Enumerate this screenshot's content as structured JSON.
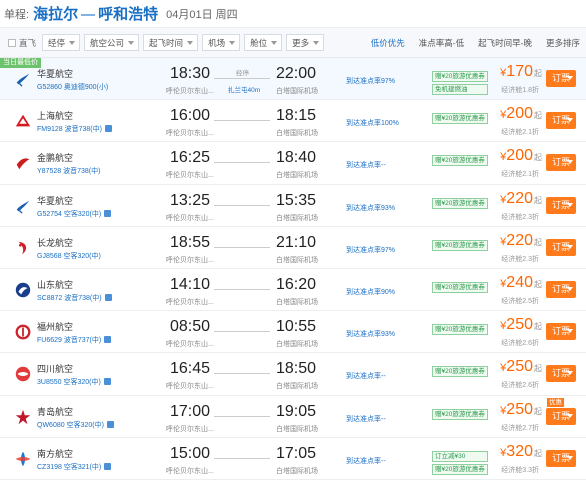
{
  "header": {
    "route_label": "单程:",
    "from_city": "海拉尔",
    "to_city": "呼和浩特",
    "date": "04月01日 周四"
  },
  "filters": {
    "direct_label": "直飞",
    "dropdowns": [
      "经停",
      "航空公司",
      "起飞时间",
      "机场",
      "舱位",
      "更多"
    ],
    "sorts": [
      "低价优先",
      "准点率高-低",
      "起飞时间早-晚",
      "更多排序"
    ],
    "active_sort_index": 0
  },
  "first_tag": "当日最低价",
  "flights": [
    {
      "airline": "华夏航空",
      "info": "G52860 奥迪德900(小)",
      "share": false,
      "dep_time": "18:30",
      "dep_airport": "呼伦贝尔东山...",
      "arr_time": "22:00",
      "arr_airport": "白塔国际机场",
      "stop_label": "经停",
      "stop_city": "扎兰屯40m",
      "ontime": "到达准点率97%",
      "badges": [
        "赠¥20旅游优惠券",
        "免机建燃油"
      ],
      "price": "170",
      "econ": "经济舱1.8折",
      "book": "订票",
      "promo": ""
    },
    {
      "airline": "上海航空",
      "info": "FM9128 波音738(中)",
      "share": true,
      "dep_time": "16:00",
      "dep_airport": "呼伦贝尔东山...",
      "arr_time": "18:15",
      "arr_airport": "白塔国际机场",
      "stop_label": "",
      "stop_city": "",
      "ontime": "到达准点率100%",
      "badges": [
        "赠¥20旅游优惠券"
      ],
      "price": "200",
      "econ": "经济舱2.1折",
      "book": "订票",
      "promo": ""
    },
    {
      "airline": "金鹏航空",
      "info": "Y87528 波音738(中)",
      "share": false,
      "dep_time": "16:25",
      "dep_airport": "呼伦贝尔东山...",
      "arr_time": "18:40",
      "arr_airport": "白塔国际机场",
      "stop_label": "",
      "stop_city": "",
      "ontime": "到达准点率--",
      "badges": [
        "赠¥20旅游优惠券"
      ],
      "price": "200",
      "econ": "经济舱2.1折",
      "book": "订票",
      "promo": ""
    },
    {
      "airline": "华夏航空",
      "info": "G52754 空客320(中)",
      "share": true,
      "dep_time": "13:25",
      "dep_airport": "呼伦贝尔东山...",
      "arr_time": "15:35",
      "arr_airport": "白塔国际机场",
      "stop_label": "",
      "stop_city": "",
      "ontime": "到达准点率93%",
      "badges": [
        "赠¥20旅游优惠券"
      ],
      "price": "220",
      "econ": "经济舱2.3折",
      "book": "订票",
      "promo": ""
    },
    {
      "airline": "长龙航空",
      "info": "GJ8568 空客320(中)",
      "share": false,
      "dep_time": "18:55",
      "dep_airport": "呼伦贝尔东山...",
      "arr_time": "21:10",
      "arr_airport": "白塔国际机场",
      "stop_label": "",
      "stop_city": "",
      "ontime": "到达准点率97%",
      "badges": [
        "赠¥20旅游优惠券"
      ],
      "price": "220",
      "econ": "经济舱2.3折",
      "book": "订票",
      "promo": ""
    },
    {
      "airline": "山东航空",
      "info": "SC8872 波音738(中)",
      "share": true,
      "dep_time": "14:10",
      "dep_airport": "呼伦贝尔东山...",
      "arr_time": "16:20",
      "arr_airport": "白塔国际机场",
      "stop_label": "",
      "stop_city": "",
      "ontime": "到达准点率90%",
      "badges": [
        "赠¥20旅游优惠券"
      ],
      "price": "240",
      "econ": "经济舱2.5折",
      "book": "订票",
      "promo": ""
    },
    {
      "airline": "福州航空",
      "info": "FU6629 波音737(中)",
      "share": true,
      "dep_time": "08:50",
      "dep_airport": "呼伦贝尔东山...",
      "arr_time": "10:55",
      "arr_airport": "白塔国际机场",
      "stop_label": "",
      "stop_city": "",
      "ontime": "到达准点率93%",
      "badges": [
        "赠¥20旅游优惠券"
      ],
      "price": "250",
      "econ": "经济舱2.6折",
      "book": "订票",
      "promo": ""
    },
    {
      "airline": "四川航空",
      "info": "3U8550 空客320(中)",
      "share": true,
      "dep_time": "16:45",
      "dep_airport": "呼伦贝尔东山...",
      "arr_time": "18:50",
      "arr_airport": "白塔国际机场",
      "stop_label": "",
      "stop_city": "",
      "ontime": "到达准点率--",
      "badges": [
        "赠¥20旅游优惠券"
      ],
      "price": "250",
      "econ": "经济舱2.6折",
      "book": "订票",
      "promo": ""
    },
    {
      "airline": "青岛航空",
      "info": "QW6080 空客320(中)",
      "share": true,
      "dep_time": "17:00",
      "dep_airport": "呼伦贝尔东山...",
      "arr_time": "19:05",
      "arr_airport": "白塔国际机场",
      "stop_label": "",
      "stop_city": "",
      "ontime": "到达准点率--",
      "badges": [
        "赠¥20旅游优惠券"
      ],
      "price": "250",
      "econ": "经济舱2.7折",
      "book": "订票",
      "promo": "优惠"
    },
    {
      "airline": "南方航空",
      "info": "CZ3198 空客321(中)",
      "share": true,
      "dep_time": "15:00",
      "dep_airport": "呼伦贝尔东山...",
      "arr_time": "17:05",
      "arr_airport": "白塔国际机场",
      "stop_label": "",
      "stop_city": "",
      "ontime": "到达准点率--",
      "badges": [
        "订立减¥30",
        "赠¥20旅游优惠券"
      ],
      "price": "320",
      "econ": "经济舱3.3折",
      "book": "订票",
      "promo": ""
    }
  ],
  "currency": "¥",
  "price_suffix": "起",
  "colors": {
    "accent": "#1a6fc4",
    "price": "#ff6600",
    "book": "#ff7a1a",
    "badge_green": "#2a9a4a"
  },
  "logo_icons": [
    "huaxia-logo-icon",
    "shanghai-air-logo-icon",
    "jinpeng-logo-icon",
    "huaxia-logo-icon",
    "loong-air-logo-icon",
    "shandong-air-logo-icon",
    "fuzhou-air-logo-icon",
    "sichuan-air-logo-icon",
    "qingdao-air-logo-icon",
    "china-southern-logo-icon"
  ]
}
